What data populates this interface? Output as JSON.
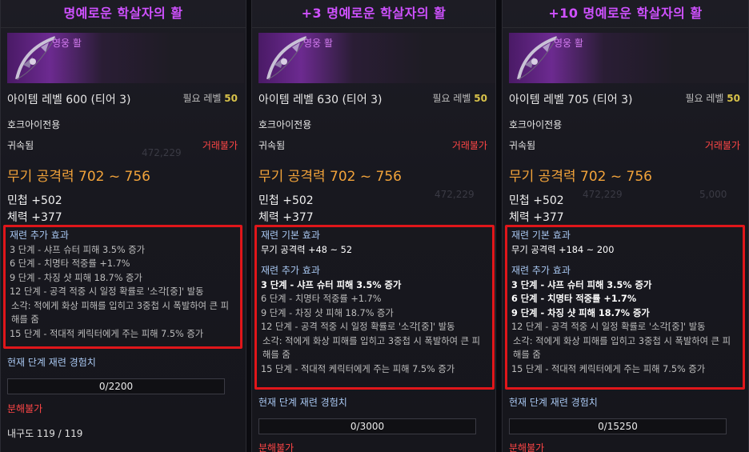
{
  "panels": [
    {
      "title": "명예로운 학살자의 활",
      "grade": "영웅 활",
      "item_level": "아이템 레벨 600 (티어 3)",
      "req_label": "필요 레벨",
      "req_value": "50",
      "class_label": "호크아이전용",
      "bound": "귀속됨",
      "trade": "거래불가",
      "attack": "무기 공격력 702 ~ 756",
      "stat1": "민첩 +502",
      "stat2": "체력 +377",
      "extra_header": "재련 추가 효과",
      "lines": [
        "3 단계 - 샤프 슈터 피해 3.5% 증가",
        "6 단계 - 치명타 적중률 +1.7%",
        "9 단계 - 차징 샷 피해 18.7% 증가",
        "12 단계 - 공격 적중 시 일정 확률로 '소각[중]' 발동",
        "소각: 적에게 화상 피해를 입히고 3중첩 시 폭발하여 큰 피해를 줌",
        "15 단계 - 적대적 케릭터에게 주는 피해 7.5% 증가"
      ],
      "exp_label": "현재 단계 재련 경험치",
      "exp_value": "0/2200",
      "no_dismantle": "분해불가",
      "durability": "내구도 119 / 119"
    },
    {
      "title": "+3 명예로운 학살자의 활",
      "grade": "영웅 활",
      "item_level": "아이템 레벨 630 (티어 3)",
      "req_label": "필요 레벨",
      "req_value": "50",
      "class_label": "호크아이전용",
      "bound": "귀속됨",
      "trade": "거래불가",
      "attack": "무기 공격력 702 ~ 756",
      "stat1": "민첩 +502",
      "stat2": "체력 +377",
      "base_header": "재련 기본 효과",
      "base_line": "무기 공격력 +48 ~ 52",
      "extra_header": "재련 추가 효과",
      "lines": [
        "3 단계 - 샤프 슈터 피해 3.5% 증가",
        "6 단계 - 치명타 적중률 +1.7%",
        "9 단계 - 차징 샷 피해 18.7% 증가",
        "12 단계 - 공격 적중 시 일정 확률로 '소각[중]' 발동",
        "소각: 적에게 화상 피해를 입히고 3중첩 시 폭발하여 큰 피해를 줌",
        "15 단계 - 적대적 케릭터에게 주는 피해 7.5% 증가"
      ],
      "exp_label": "현재 단계 재련 경험치",
      "exp_value": "0/3000",
      "no_dismantle": "분해불가"
    },
    {
      "title": "+10 명예로운 학살자의 활",
      "grade": "영웅 활",
      "item_level": "아이템 레벨 705 (티어 3)",
      "req_label": "필요 레벨",
      "req_value": "50",
      "class_label": "호크아이전용",
      "bound": "귀속됨",
      "trade": "거래불가",
      "attack": "무기 공격력 702 ~ 756",
      "stat1": "민첩 +502",
      "stat2": "체력 +377",
      "base_header": "재련 기본 효과",
      "base_line": "무기 공격력 +184 ~ 200",
      "extra_header": "재련 추가 효과",
      "lines": [
        "3 단계 - 샤프 슈터 피해 3.5% 증가",
        "6 단계 - 치명타 적중률 +1.7%",
        "9 단계 - 차징 샷 피해 18.7% 증가",
        "12 단계 - 공격 적중 시 일정 확률로 '소각[중]' 발동",
        "소각: 적에게 화상 피해를 입히고 3중첩 시 폭발하여 큰 피해를 줌",
        "15 단계 - 적대적 케릭터에게 주는 피해 7.5% 증가"
      ],
      "exp_label": "현재 단계 재련 경험치",
      "exp_value": "0/15250",
      "no_dismantle": "분해불가"
    }
  ],
  "background_numbers": [
    "472,229",
    "472,229",
    "472,229",
    "5,000"
  ],
  "colors": {
    "title": "#cf51ff",
    "attack": "#f2a33a",
    "untradeable": "#ff4646",
    "highlight_border": "#e0161a",
    "section_header": "#a9c8f2"
  }
}
